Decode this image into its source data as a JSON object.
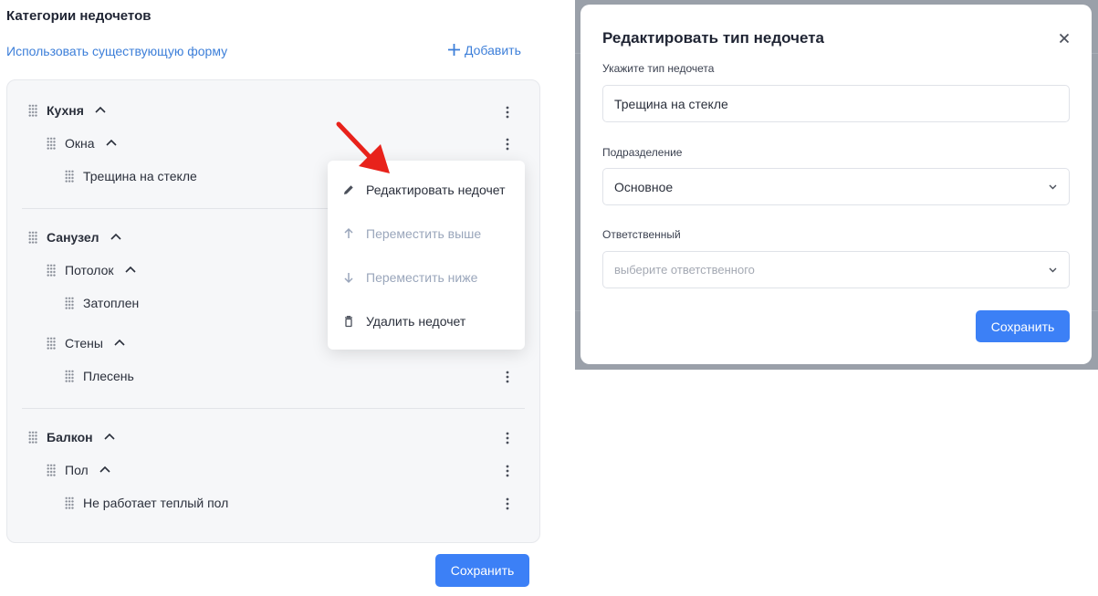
{
  "header": {
    "title": "Категории недочетов",
    "use_existing_form": "Использовать существующую форму",
    "add_label": "Добавить"
  },
  "tree": [
    {
      "label": "Кухня",
      "children": [
        {
          "label": "Окна",
          "children": [
            {
              "label": "Трещина на стекле"
            }
          ]
        }
      ]
    },
    {
      "label": "Санузел",
      "children": [
        {
          "label": "Потолок",
          "children": [
            {
              "label": "Затоплен"
            }
          ]
        },
        {
          "label": "Стены",
          "children": [
            {
              "label": "Плесень"
            }
          ]
        }
      ]
    },
    {
      "label": "Балкон",
      "children": [
        {
          "label": "Пол",
          "children": [
            {
              "label": "Не работает теплый пол"
            }
          ]
        }
      ]
    }
  ],
  "context_menu": {
    "items": [
      {
        "label": "Редактировать недочет",
        "icon": "pencil-icon",
        "disabled": false
      },
      {
        "label": "Переместить выше",
        "icon": "arrow-up-icon",
        "disabled": true
      },
      {
        "label": "Переместить ниже",
        "icon": "arrow-down-icon",
        "disabled": true
      },
      {
        "label": "Удалить недочет",
        "icon": "trash-icon",
        "disabled": false
      }
    ]
  },
  "footer": {
    "save_label": "Сохранить"
  },
  "modal": {
    "title": "Редактировать тип недочета",
    "type_label": "Укажите тип недочета",
    "type_value": "Трещина на стекле",
    "division_label": "Подразделение",
    "division_value": "Основное",
    "responsible_label": "Ответственный",
    "responsible_placeholder": "выберите ответственного",
    "save_label": "Сохранить"
  },
  "colors": {
    "accent": "#3c80f6",
    "link": "#3d7fd9",
    "annotation_arrow": "#e8221b",
    "overlay": "#9aa0a9"
  }
}
